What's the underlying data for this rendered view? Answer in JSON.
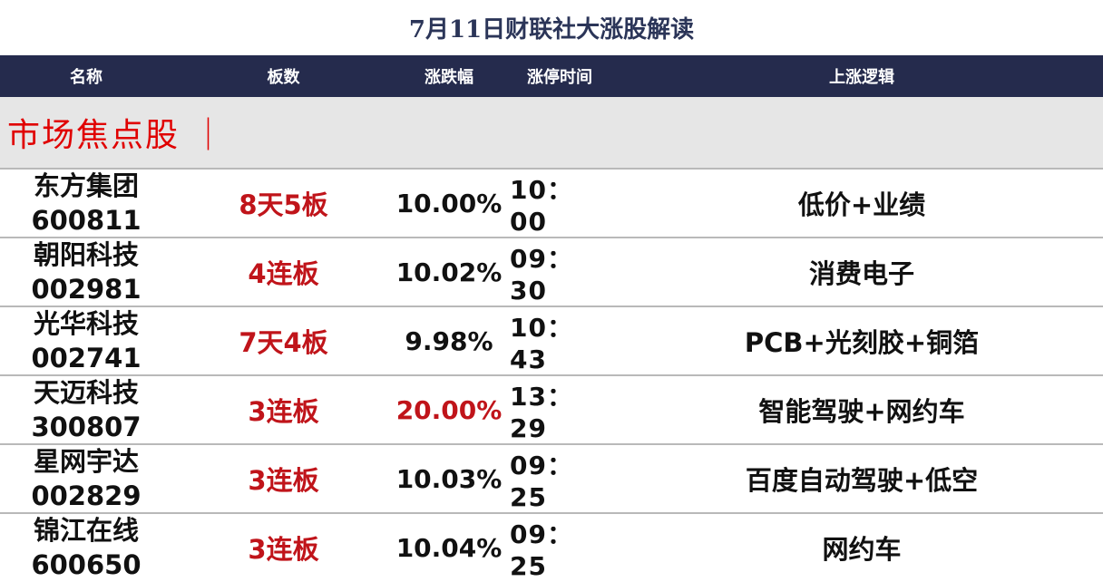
{
  "title": "7月11日财联社大涨股解读",
  "columns": {
    "name": "名称",
    "boards": "板数",
    "change": "涨跌幅",
    "limit_time": "涨停时间",
    "logic": "上涨逻辑"
  },
  "section": {
    "label": "市场焦点股 ｜"
  },
  "rows": [
    {
      "name": "东方集团",
      "code": "600811",
      "boards": "8天5板",
      "change": "10.00%",
      "limit_time": "10：00",
      "logic": "低价+业绩"
    },
    {
      "name": "朝阳科技",
      "code": "002981",
      "boards": "4连板",
      "change": "10.02%",
      "limit_time": "09：30",
      "logic": "消费电子"
    },
    {
      "name": "光华科技",
      "code": "002741",
      "boards": "7天4板",
      "change": "9.98%",
      "limit_time": "10：43",
      "logic": "PCB+光刻胶+铜箔"
    },
    {
      "name": "天迈科技",
      "code": "300807",
      "boards": "3连板",
      "change": "20.00%",
      "limit_time": "13：29",
      "logic": "智能驾驶+网约车"
    },
    {
      "name": "星网宇达",
      "code": "002829",
      "boards": "3连板",
      "change": "10.03%",
      "limit_time": "09：25",
      "logic": "百度自动驾驶+低空"
    },
    {
      "name": "锦江在线",
      "code": "600650",
      "boards": "3连板",
      "change": "10.04%",
      "limit_time": "09：25",
      "logic": "网约车"
    }
  ],
  "colors": {
    "header_bg": "#252b4d",
    "title_text": "#2b3558",
    "accent_red": "#c0141a",
    "section_bg": "#e6e6e6"
  }
}
